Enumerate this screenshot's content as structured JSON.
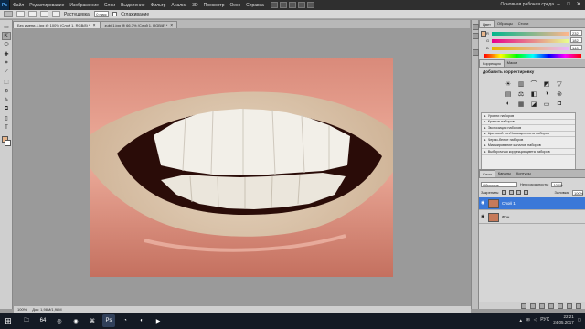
{
  "menubar": {
    "logo": "Ps",
    "items": [
      "Файл",
      "Редактирование",
      "Изображение",
      "Слои",
      "Выделение",
      "Фильтр",
      "Анализ",
      "3D",
      "Просмотр",
      "Окно",
      "Справка"
    ],
    "workspace": "Основная рабочая среда",
    "controls": [
      "–",
      "□",
      "✕"
    ]
  },
  "options_bar": {
    "feather_label": "Растушевка:",
    "feather_value": "0 пикс",
    "antialias_label": "Сглаживание"
  },
  "doc_tabs": [
    {
      "title": "Без имени-1.jpg @ 100% (Слой 1, RGB/8) *",
      "active": true
    },
    {
      "title": "zubi-1.jpg @ 66,7% (Слой 1, RGB/8) *",
      "active": false
    }
  ],
  "tools": [
    "▭",
    "⇱",
    "⬭",
    "✚",
    "⌗",
    "⟋",
    "⬚",
    "⊘",
    "✎",
    "⧉",
    "▯",
    "✥",
    "◈",
    "◍",
    "⌇",
    "T",
    "↖",
    "◇",
    "✋",
    "⚲"
  ],
  "colors": {
    "foreground": "#e8b68c",
    "background": "#ffffff",
    "accent": "#3b78d8"
  },
  "status_bar": {
    "zoom": "100%",
    "doc_info": "Док: 1,98М/1,98М"
  },
  "color_panel": {
    "tabs": [
      "Цвет",
      "Образцы",
      "Стили"
    ],
    "sliders": [
      {
        "label": "R",
        "value": "232"
      },
      {
        "label": "G",
        "value": "182"
      },
      {
        "label": "B",
        "value": "140"
      }
    ]
  },
  "adjustments_panel": {
    "tabs": [
      "Коррекция",
      "Маски"
    ],
    "title": "Добавить корректировку",
    "presets": [
      "Уровни наборов",
      "Кривые наборов",
      "Экспозиция наборов",
      "Цветовой тон/Насыщенность наборов",
      "Черно-белое наборов",
      "Микширование каналов наборов",
      "Выборочная коррекция цвета наборов"
    ]
  },
  "layers_panel": {
    "tabs": [
      "Слои",
      "Каналы",
      "Контуры"
    ],
    "blend_mode": "Обычные",
    "opacity_label": "Непрозрачность:",
    "opacity": "100%",
    "lock_label": "Закрепить:",
    "fill_label": "Заливка:",
    "fill": "100%",
    "layers": [
      {
        "name": "Слой 1",
        "selected": true
      },
      {
        "name": "Фон",
        "selected": false
      }
    ]
  },
  "taskbar": {
    "start": "⊞",
    "apps": [
      "🗀",
      "64",
      "◎",
      "◉",
      "⌘",
      "Ps",
      "◔",
      "◐",
      "▶"
    ],
    "language": "РУС",
    "time": "22:21",
    "date": "24.05.2017"
  }
}
